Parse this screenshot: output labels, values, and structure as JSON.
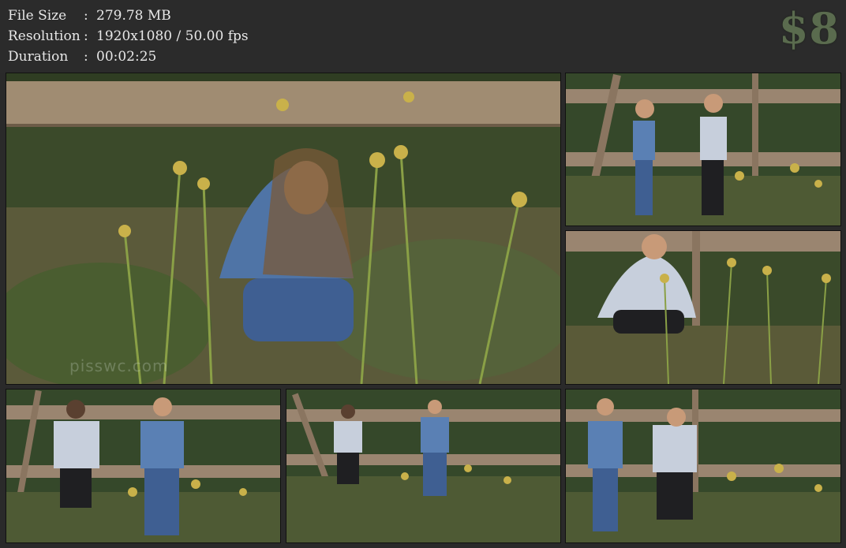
{
  "file_info": {
    "file_size_label": "File Size",
    "file_size_value": "279.78 MB",
    "resolution_label": "Resolution",
    "resolution_value": "1920x1080 / 50.00 fps",
    "duration_label": "Duration",
    "duration_value": "00:02:25",
    "separator": ":"
  },
  "price": "$8",
  "watermark": "pisswc.com",
  "thumbnails": [
    {
      "name": "thumbnail-1-main"
    },
    {
      "name": "thumbnail-2"
    },
    {
      "name": "thumbnail-3"
    },
    {
      "name": "thumbnail-4"
    },
    {
      "name": "thumbnail-5"
    },
    {
      "name": "thumbnail-6"
    }
  ],
  "colors": {
    "background": "#2a2a2a",
    "header_text": "#e8e8e8",
    "price_text": "#5a6b4e"
  }
}
